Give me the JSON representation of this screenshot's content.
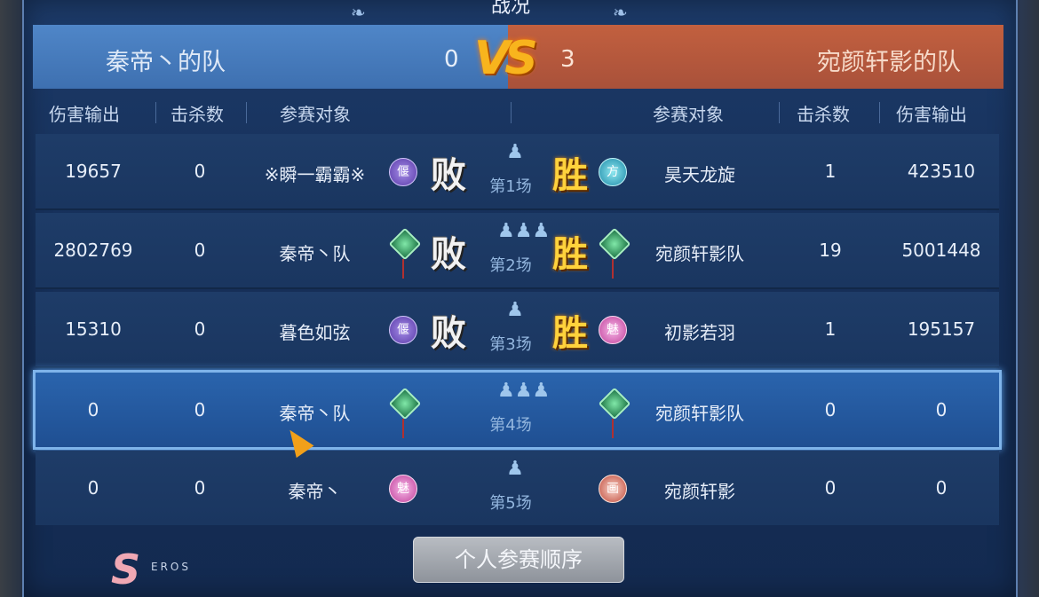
{
  "window_title": "战况",
  "header": {
    "left_team": "秦帝丶的队",
    "left_score": "0",
    "vs_label": "VS",
    "right_score": "3",
    "right_team": "宛颜轩影的队"
  },
  "columns": {
    "dmg": "伤害输出",
    "kills": "击杀数",
    "participant": "参赛对象"
  },
  "matches": [
    {
      "dmg_l": "19657",
      "kills_l": "0",
      "name_l": "※瞬一霸霸※",
      "badge_l": "偃",
      "result_l": "败",
      "label": "第1场",
      "result_r": "胜",
      "badge_r": "方",
      "name_r": "昊天龙旋",
      "kills_r": "1",
      "dmg_r": "423510"
    },
    {
      "dmg_l": "2802769",
      "kills_l": "0",
      "name_l": "秦帝丶队",
      "result_l": "败",
      "label": "第2场",
      "result_r": "胜",
      "name_r": "宛颜轩影队",
      "kills_r": "19",
      "dmg_r": "5001448"
    },
    {
      "dmg_l": "15310",
      "kills_l": "0",
      "name_l": "暮色如弦",
      "badge_l": "偃",
      "result_l": "败",
      "label": "第3场",
      "result_r": "胜",
      "badge_r": "魅",
      "name_r": "初影若羽",
      "kills_r": "1",
      "dmg_r": "195157"
    },
    {
      "dmg_l": "0",
      "kills_l": "0",
      "name_l": "秦帝丶队",
      "label": "第4场",
      "name_r": "宛颜轩影队",
      "kills_r": "0",
      "dmg_r": "0"
    },
    {
      "dmg_l": "0",
      "kills_l": "0",
      "name_l": "秦帝丶",
      "badge_l": "魅",
      "label": "第5场",
      "badge_r": "画",
      "name_r": "宛颜轩影",
      "kills_r": "0",
      "dmg_r": "0"
    }
  ],
  "order_button": "个人参赛顺序",
  "logo_text": "EROS",
  "colors": {
    "left_team": "#4f86c8",
    "right_team": "#c2603f",
    "win": "#ffd23c",
    "selected_row": "#2a64ad"
  }
}
